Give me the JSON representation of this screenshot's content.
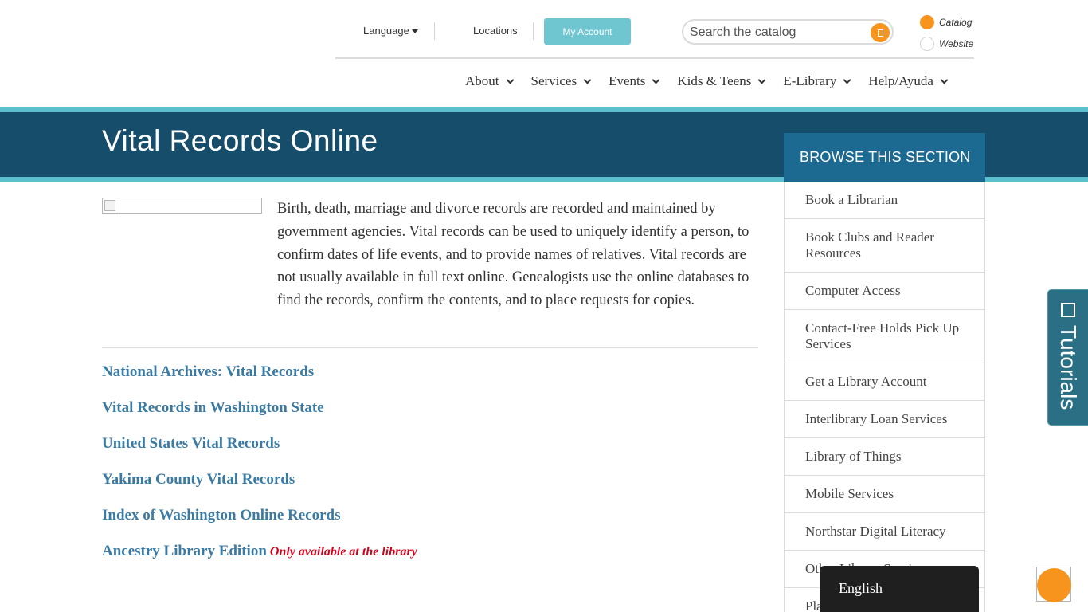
{
  "header": {
    "language_label": "Language",
    "locations_label": "Locations",
    "my_account_label": "My Account",
    "search": {
      "placeholder": "Search the catalog",
      "icon": "search-icon"
    },
    "scope": [
      {
        "label": "Catalog",
        "selected": true
      },
      {
        "label": "Website",
        "selected": false
      }
    ]
  },
  "nav": {
    "items": [
      {
        "label": "About"
      },
      {
        "label": "Services"
      },
      {
        "label": "Events"
      },
      {
        "label": "Kids & Teens"
      },
      {
        "label": "E-Library"
      },
      {
        "label": "Help/Ayuda"
      }
    ]
  },
  "page": {
    "title": "Vital Records Online",
    "intro": "Birth, death, marriage and divorce records are recorded and maintained by government agencies. Vital records can be used to uniquely identify a person, to confirm dates of life events, and to provide names of relatives. Vital records are not usually available in full text online. Genealogists use the online databases to find the records, confirm the contents, and to place requests for copies.",
    "links": [
      {
        "label": "National Archives: Vital Records",
        "note": ""
      },
      {
        "label": "Vital Records in Washington State",
        "note": ""
      },
      {
        "label": "United States Vital Records",
        "note": ""
      },
      {
        "label": "Yakima County Vital Records",
        "note": ""
      },
      {
        "label": "Index of Washington Online Records",
        "note": ""
      },
      {
        "label": "Ancestry Library Edition",
        "note": "Only available at the library"
      }
    ]
  },
  "sidebar": {
    "heading": "BROWSE THIS SECTION",
    "items": [
      {
        "label": "Book a Librarian"
      },
      {
        "label": "Book Clubs and Reader Resources"
      },
      {
        "label": "Computer Access"
      },
      {
        "label": "Contact-Free Holds Pick Up Services"
      },
      {
        "label": "Get a Library Account"
      },
      {
        "label": "Interlibrary Loan Services"
      },
      {
        "label": "Library of Things"
      },
      {
        "label": "Mobile Services"
      },
      {
        "label": "Northstar Digital Literacy"
      },
      {
        "label": "Other Library Services"
      },
      {
        "label": "Pla"
      }
    ]
  },
  "tutorials": {
    "label": "Tutorials"
  },
  "language_popup": {
    "label": "English"
  },
  "colors": {
    "banner": "#164d6b",
    "accent_teal": "#5bbfcc",
    "sidebar_header": "#1c6a91",
    "orange": "#f7941d",
    "link": "#3a7aa3",
    "note_red": "#d0021b"
  }
}
